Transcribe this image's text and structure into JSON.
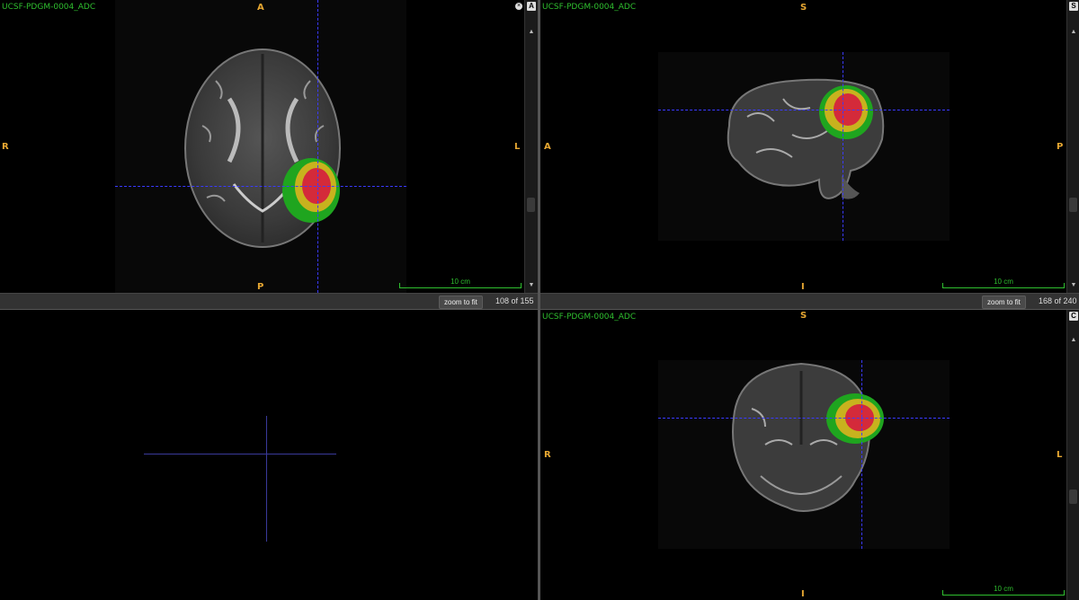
{
  "axial": {
    "title": "UCSF-PDGM-0004_ADC",
    "orient": {
      "top": "A",
      "bottom": "P",
      "left": "R",
      "right": "L"
    },
    "scale_label": "10 cm",
    "zoom_label": "zoom to fit",
    "slice": "108 of 155",
    "scroll_button": "A"
  },
  "sagittal": {
    "title": "UCSF-PDGM-0004_ADC",
    "orient": {
      "top": "S",
      "bottom": "I",
      "left": "A",
      "right": "P"
    },
    "scale_label": "10 cm",
    "zoom_label": "zoom to fit",
    "slice": "168 of 240",
    "scroll_button": "S"
  },
  "coronal": {
    "title": "UCSF-PDGM-0004_ADC",
    "orient": {
      "top": "S",
      "bottom": "I",
      "left": "R",
      "right": "L"
    },
    "scale_label": "10 cm",
    "scroll_button": "C"
  },
  "colors": {
    "label_text": "#2fbf2f",
    "orientation": "#e8a832",
    "crosshair": "#3a3aff",
    "tumor_core": "#d42a3a",
    "tumor_mid": "#c8b21e",
    "tumor_edge": "#1fa51f"
  }
}
